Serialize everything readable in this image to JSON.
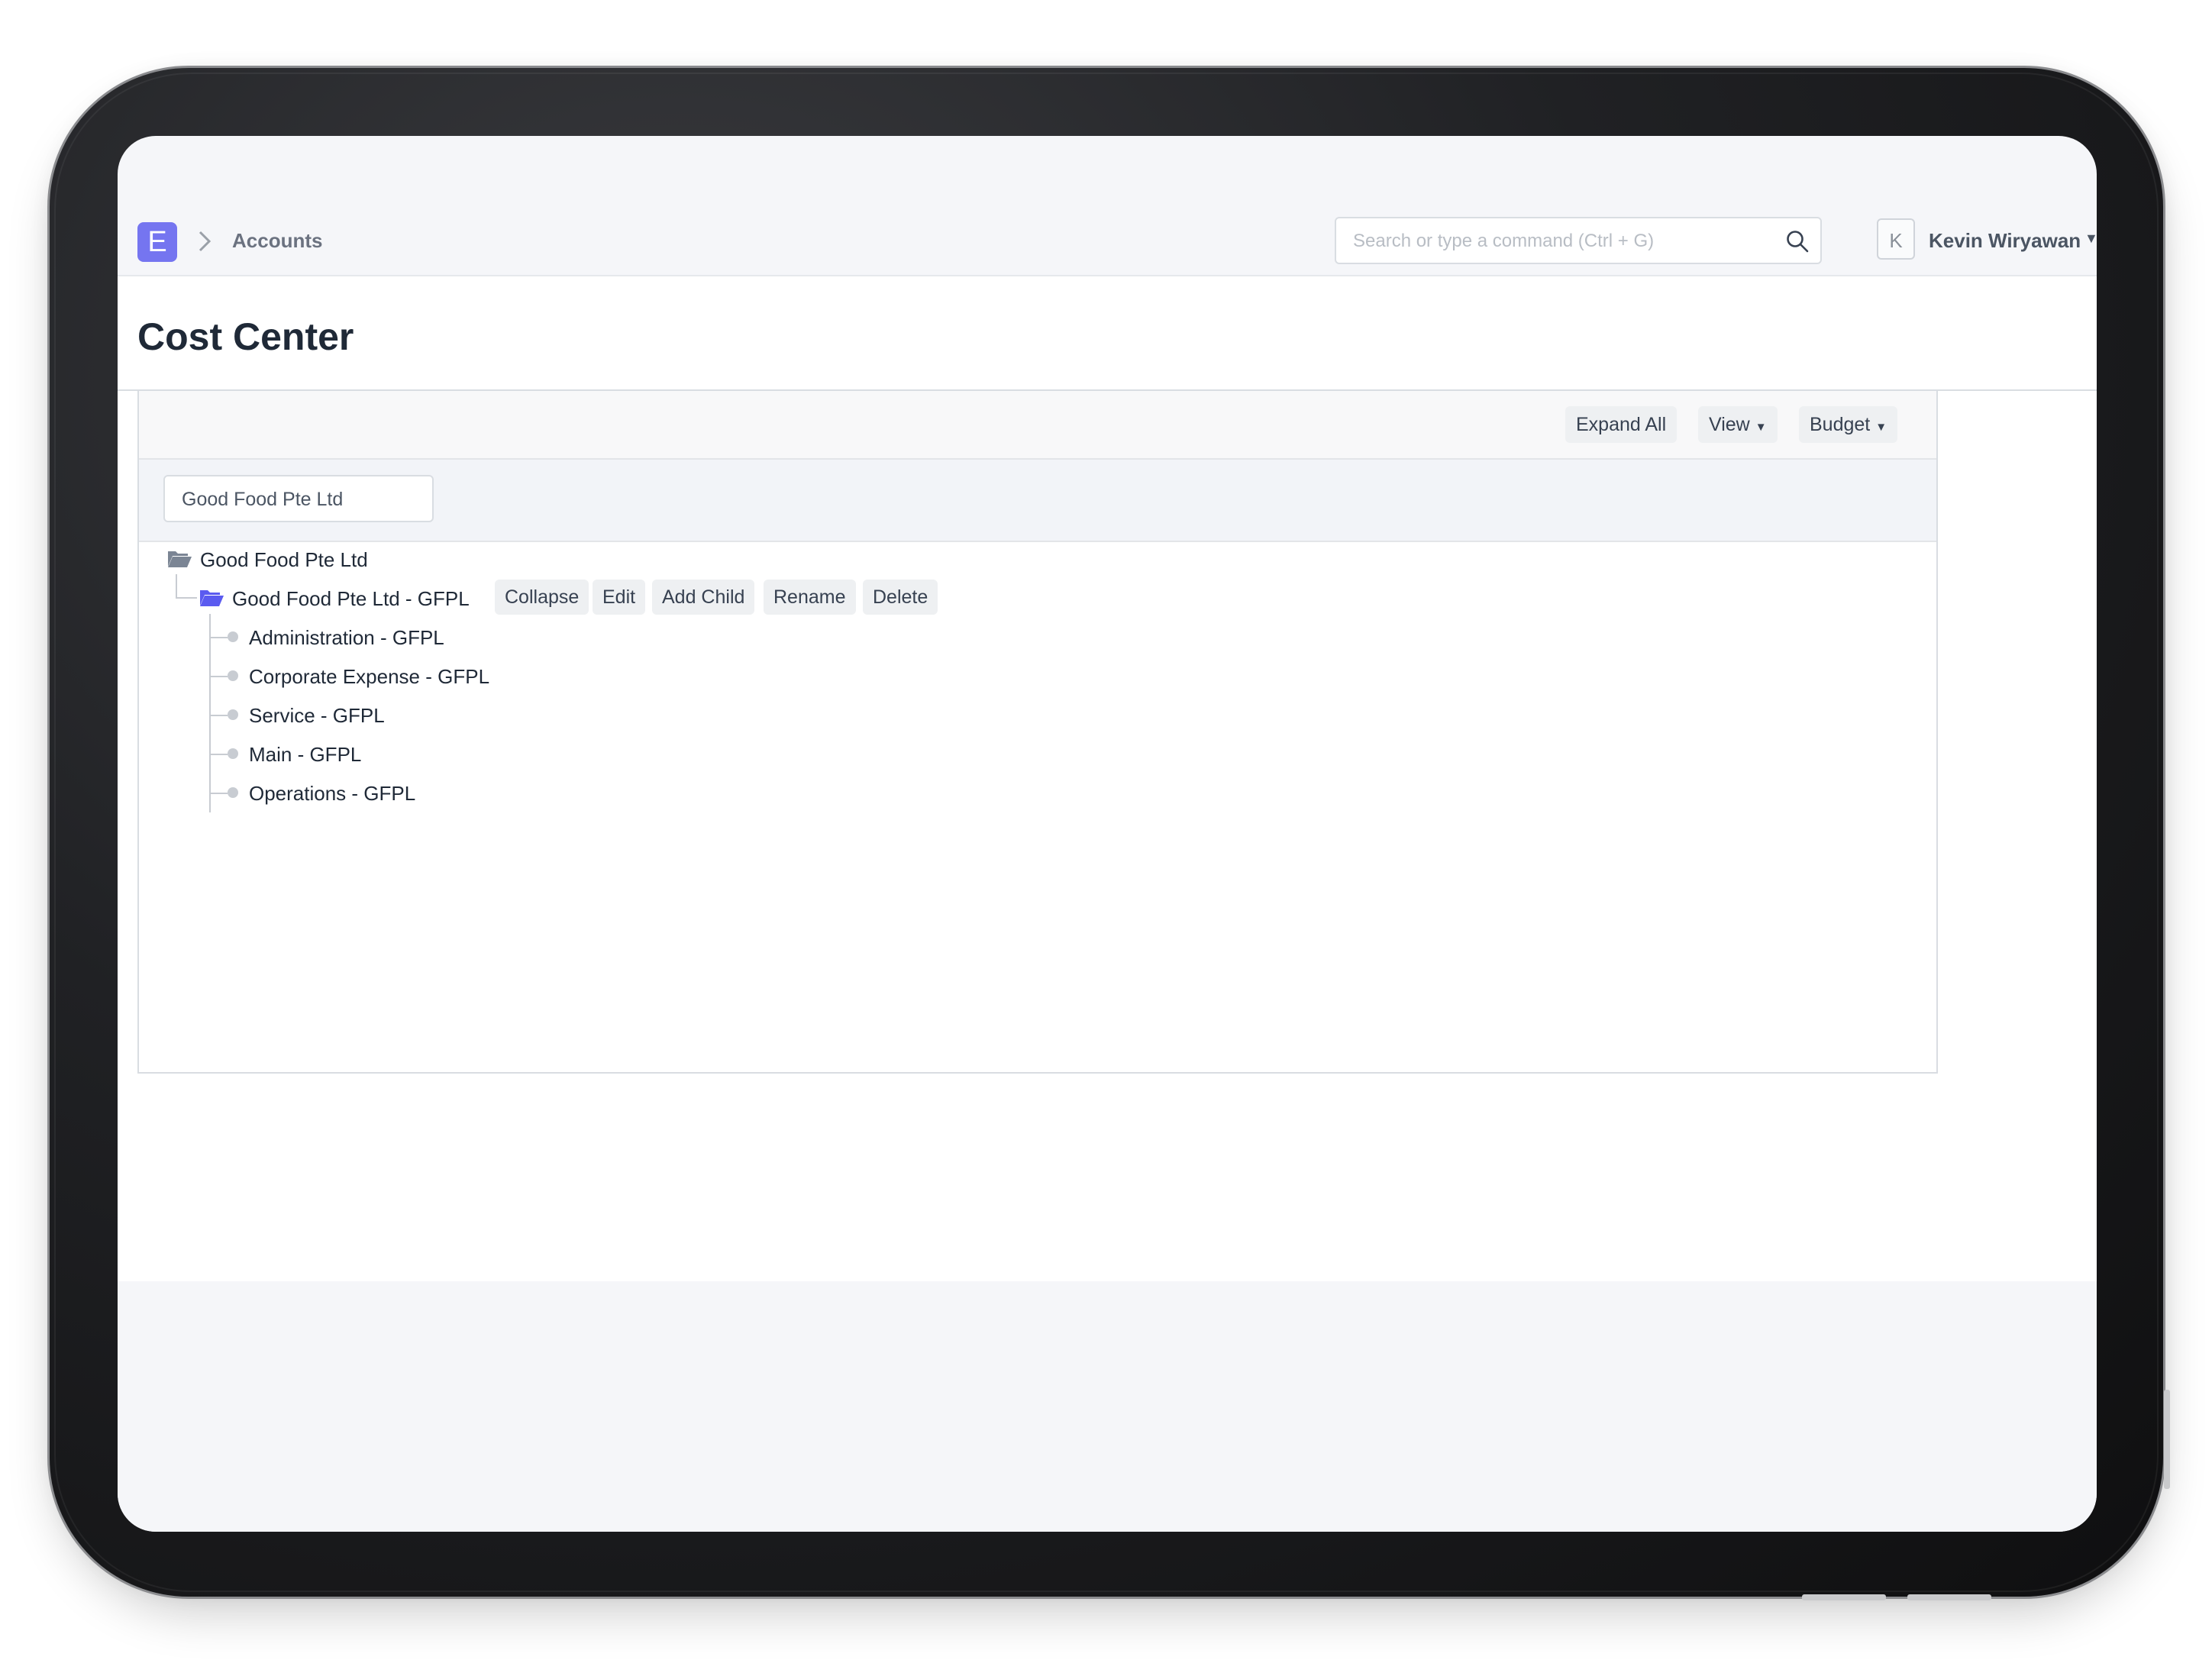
{
  "navbar": {
    "logo_letter": "E",
    "breadcrumb": "Accounts",
    "search_placeholder": "Search or type a command (Ctrl + G)",
    "avatar_initial": "K",
    "user_name": "Kevin Wiryawan"
  },
  "page": {
    "title": "Cost Center"
  },
  "toolbar": {
    "expand_all": "Expand All",
    "view": "View",
    "budget": "Budget"
  },
  "filter": {
    "company": "Good Food Pte Ltd"
  },
  "tree": {
    "root": "Good Food Pte Ltd",
    "group": "Good Food Pte Ltd - GFPL",
    "group_actions": [
      "Collapse",
      "Edit",
      "Add Child",
      "Rename",
      "Delete"
    ],
    "children": [
      "Administration - GFPL",
      "Corporate Expense - GFPL",
      "Service - GFPL",
      "Main - GFPL",
      "Operations - GFPL"
    ]
  },
  "icons": {
    "search": "search-icon",
    "folder_open": "folder-open-icon",
    "caret": "caret-down-icon",
    "chevron": "chevron-right-icon"
  },
  "colors": {
    "brand": "#7575f0",
    "folder_active": "#5b5bf0",
    "folder_root": "#7b8594"
  }
}
